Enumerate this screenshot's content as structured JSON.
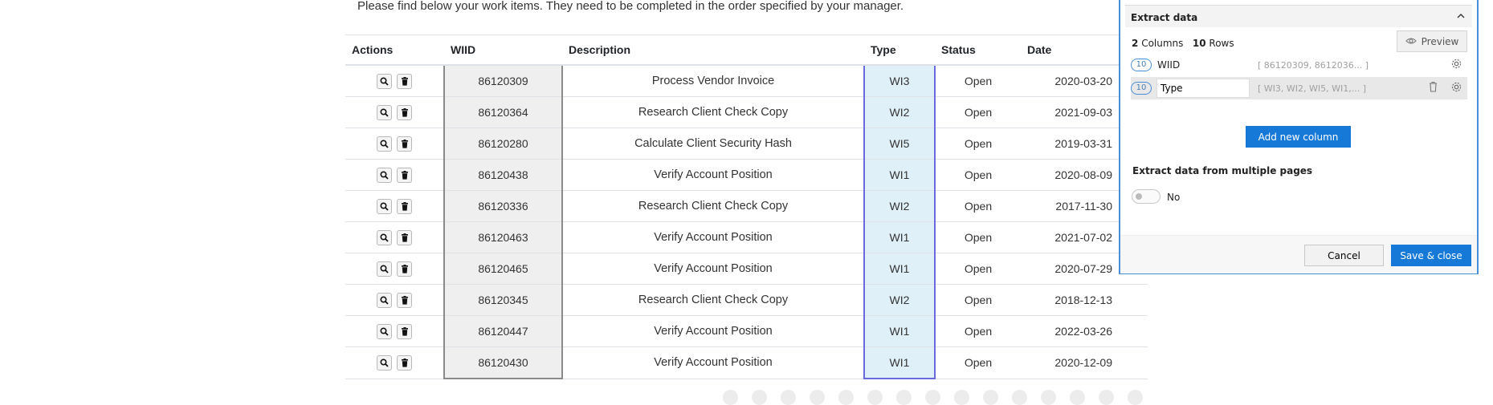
{
  "intro_text": "Please find below your work items. They need to be completed in the order specified by your manager.",
  "table": {
    "headers": [
      "Actions",
      "WIID",
      "Description",
      "Type",
      "Status",
      "Date"
    ],
    "rows": [
      {
        "wiid": "86120309",
        "description": "Process Vendor Invoice",
        "type": "WI3",
        "status": "Open",
        "date": "2020-03-20"
      },
      {
        "wiid": "86120364",
        "description": "Research Client Check Copy",
        "type": "WI2",
        "status": "Open",
        "date": "2021-09-03"
      },
      {
        "wiid": "86120280",
        "description": "Calculate Client Security Hash",
        "type": "WI5",
        "status": "Open",
        "date": "2019-03-31"
      },
      {
        "wiid": "86120438",
        "description": "Verify Account Position",
        "type": "WI1",
        "status": "Open",
        "date": "2020-08-09"
      },
      {
        "wiid": "86120336",
        "description": "Research Client Check Copy",
        "type": "WI2",
        "status": "Open",
        "date": "2017-11-30"
      },
      {
        "wiid": "86120463",
        "description": "Verify Account Position",
        "type": "WI1",
        "status": "Open",
        "date": "2021-07-02"
      },
      {
        "wiid": "86120465",
        "description": "Verify Account Position",
        "type": "WI1",
        "status": "Open",
        "date": "2020-07-29"
      },
      {
        "wiid": "86120345",
        "description": "Research Client Check Copy",
        "type": "WI2",
        "status": "Open",
        "date": "2018-12-13"
      },
      {
        "wiid": "86120447",
        "description": "Verify Account Position",
        "type": "WI1",
        "status": "Open",
        "date": "2022-03-26"
      },
      {
        "wiid": "86120430",
        "description": "Verify Account Position",
        "type": "WI1",
        "status": "Open",
        "date": "2020-12-09"
      }
    ]
  },
  "panel": {
    "title": "Extract data",
    "columns_count": "2",
    "columns_label": "Columns",
    "rows_count": "10",
    "rows_label": "Rows",
    "preview_label": "Preview",
    "columns": [
      {
        "count": "10",
        "name": "WIID",
        "preview": "[ 86120309, 8612036... ]"
      },
      {
        "count": "10",
        "name": "Type",
        "preview": "[ WI3, WI2, WI5, WI1,... ]"
      }
    ],
    "add_column_label": "Add new column",
    "multi_pages_title": "Extract data from multiple pages",
    "multi_pages_value": "No",
    "cancel_label": "Cancel",
    "save_label": "Save & close"
  },
  "colors": {
    "accent": "#1679d8",
    "wiid_highlight": "#efefef",
    "type_highlight": "#dff0f8"
  }
}
